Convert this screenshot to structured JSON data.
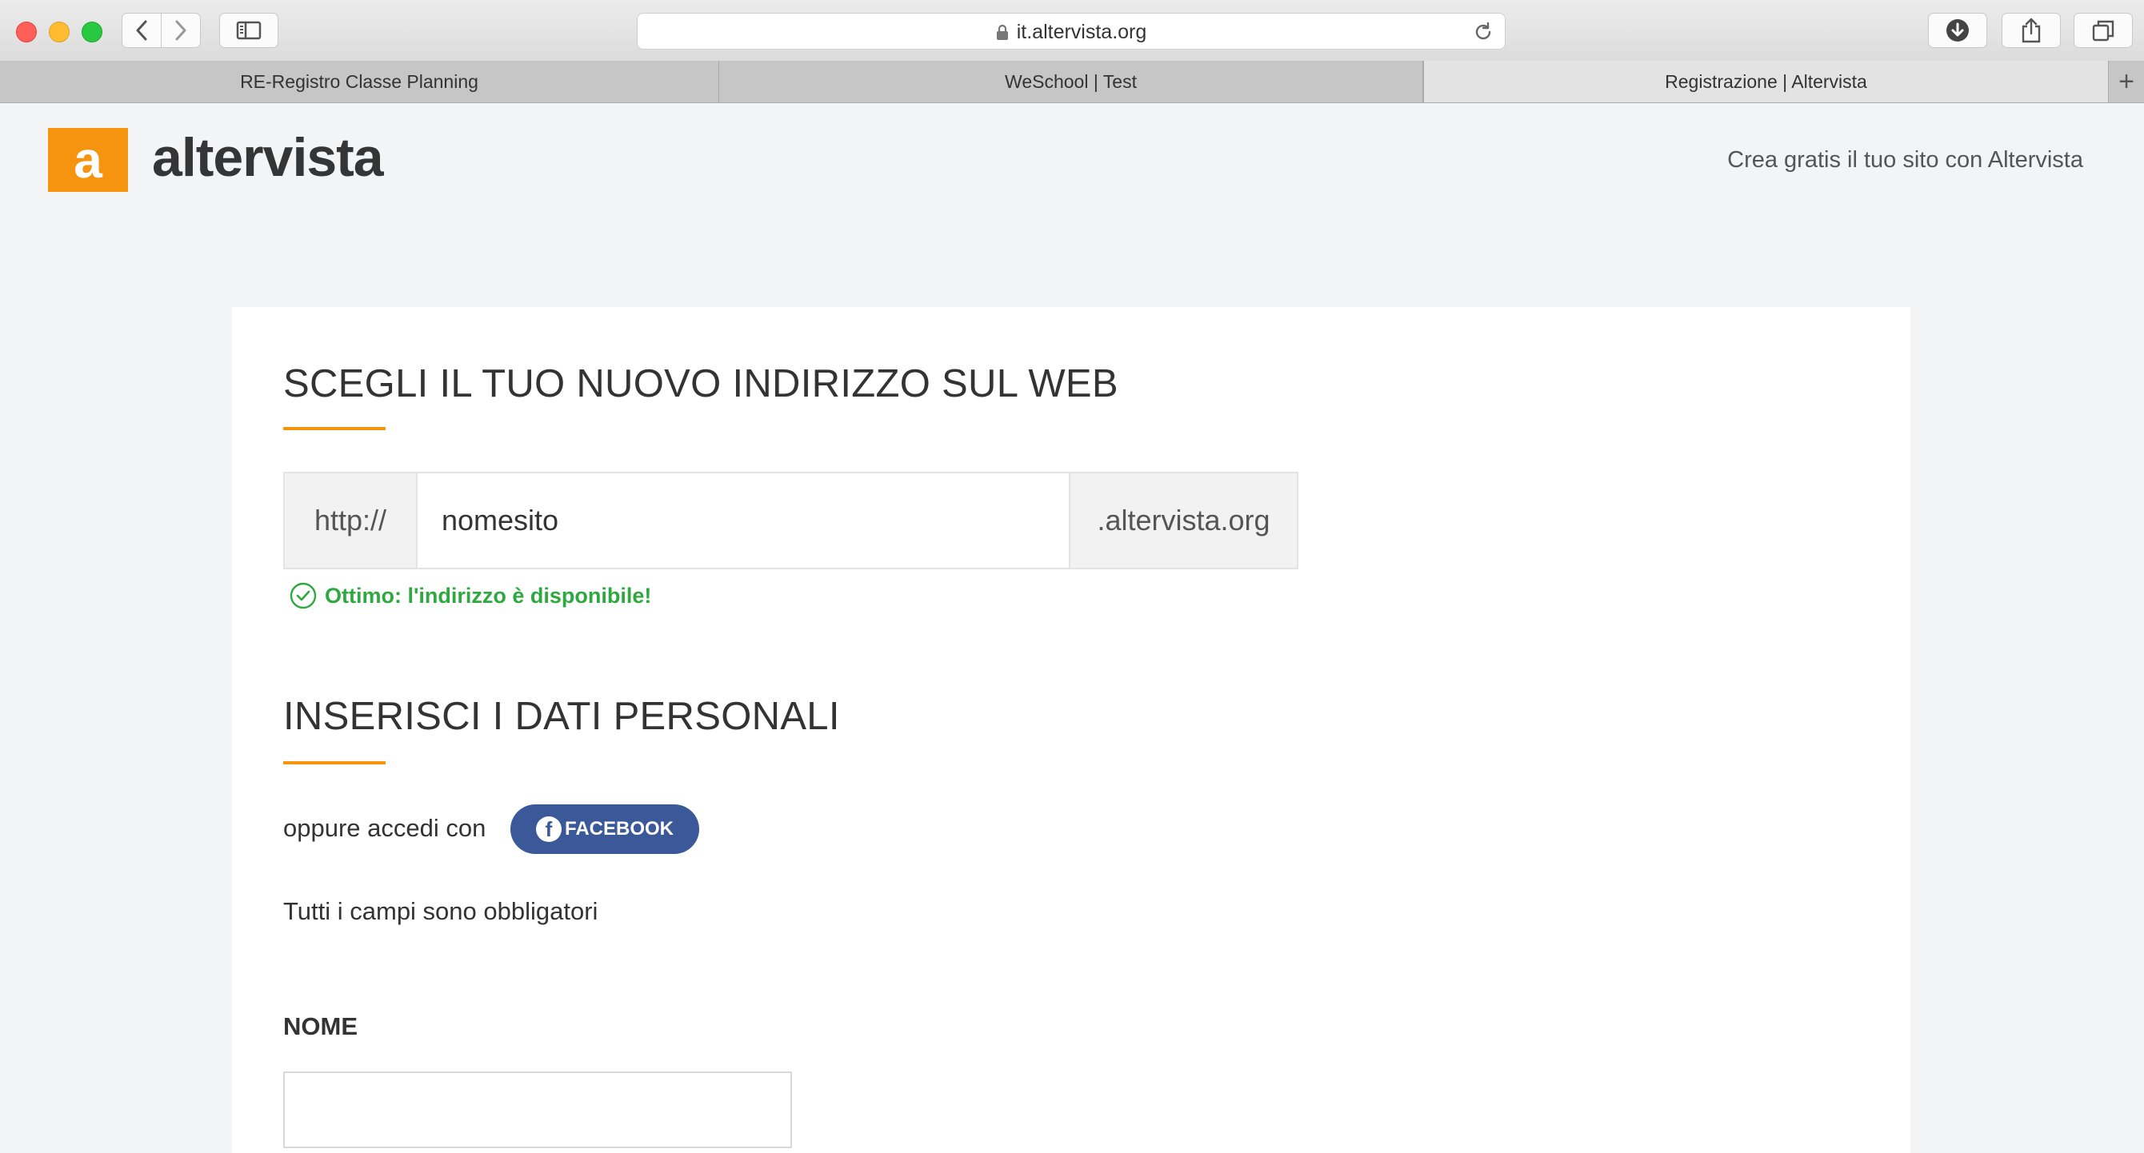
{
  "browser": {
    "url": "it.altervista.org",
    "tabs": [
      {
        "label": "RE-Registro Classe Planning"
      },
      {
        "label": "WeSchool | Test"
      },
      {
        "label": "Registrazione | Altervista"
      }
    ],
    "new_tab_label": "+"
  },
  "header": {
    "logo_letter": "a",
    "logo_name": "altervista",
    "tagline": "Crea gratis il tuo sito con Altervista",
    "brand_color": "#f7940f"
  },
  "address_section": {
    "title": "SCEGLI IL TUO NUOVO INDIRIZZO SUL WEB",
    "prefix": "http://",
    "site_value": "nomesito",
    "suffix": ".altervista.org",
    "status_text": "Ottimo: l'indirizzo è disponibile!",
    "status_color": "#2fa83f"
  },
  "personal_section": {
    "title": "INSERISCI I DATI PERSONALI",
    "or_login_text": "oppure accedi con",
    "facebook_label": "FACEBOOK",
    "facebook_icon_letter": "f",
    "facebook_color": "#3b5998",
    "required_note": "Tutti i campi sono obbligatori",
    "name_label": "NOME",
    "name_value": ""
  }
}
